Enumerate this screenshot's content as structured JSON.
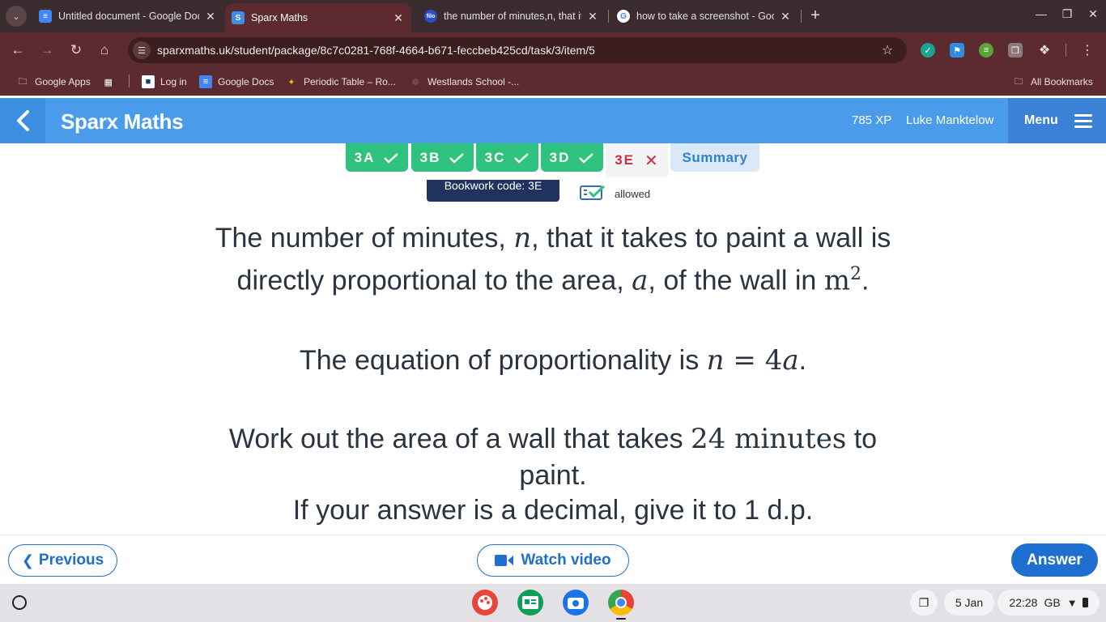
{
  "browser": {
    "tabs": [
      {
        "title": "Untitled document - Google Docs",
        "favicon": "google-docs-icon",
        "active": false
      },
      {
        "title": "Sparx Maths",
        "favicon": "sparx-icon",
        "active": true
      },
      {
        "title": "the number of minutes,n, that it takes",
        "favicon": "filo-icon",
        "active": false
      },
      {
        "title": "how to take a screenshot - Google Search",
        "favicon": "google-icon",
        "active": false
      }
    ],
    "url": "sparxmaths.uk/student/package/8c7c0281-768f-4664-b671-feccbeb425cd/task/3/item/5",
    "bookmarks": [
      {
        "label": "Google Apps",
        "icon": "apps-grid-icon"
      },
      {
        "label": "Log in",
        "icon": "login-icon"
      },
      {
        "label": "Google Docs",
        "icon": "google-docs-icon"
      },
      {
        "label": "Periodic Table – Ro...",
        "icon": "periodic-table-icon"
      },
      {
        "label": "Westlands School -...",
        "icon": "school-icon"
      }
    ],
    "all_bookmarks": "All Bookmarks",
    "tab_favicon_letters": {
      "docs": "≡",
      "sparx": "S",
      "filo": "filo",
      "google": "G"
    }
  },
  "header": {
    "brand": "Sparx Maths",
    "xp": "785 XP",
    "user": "Luke Manktelow",
    "menu": "Menu"
  },
  "task_tabs": [
    {
      "label": "3A",
      "status": "complete"
    },
    {
      "label": "3B",
      "status": "complete"
    },
    {
      "label": "3C",
      "status": "complete"
    },
    {
      "label": "3D",
      "status": "complete"
    },
    {
      "label": "3E",
      "status": "current-incorrect"
    },
    {
      "label": "Summary",
      "status": "summary"
    }
  ],
  "bookwork": {
    "code_text": "Bookwork code: 3E",
    "calculator": "allowed"
  },
  "question": {
    "line1_a": "The number of minutes, ",
    "var_n": "n",
    "line1_b": ", that it takes to paint a wall is",
    "line2_a": "directly proportional to the area, ",
    "var_a": "a",
    "line2_b": ", of the wall in ",
    "unit": "m",
    "unit_power": "2",
    "line2_c": ".",
    "line3_a": "The equation of proportionality is ",
    "equation_lhs": "n",
    "equation_eq": " = ",
    "equation_coef": "4",
    "equation_var": "a",
    "line3_b": ".",
    "line4_a": "Work out the area of a wall that takes ",
    "minutes_value": "24",
    "minutes_unit": " minutes",
    "line4_b": " to",
    "line5": "paint.",
    "line6": "If your answer is a decimal, give it to 1 d.p."
  },
  "nav": {
    "previous": "Previous",
    "watch_video": "Watch video",
    "answer": "Answer"
  },
  "shelf": {
    "date": "5 Jan",
    "time": "22:28",
    "locale": "GB"
  },
  "colors": {
    "header_blue": "#4a9bea",
    "complete_green": "#2ec27e",
    "incorrect_red": "#d12c47",
    "button_blue": "#1f6fd1",
    "chrome_maroon": "#5b2b2f"
  }
}
